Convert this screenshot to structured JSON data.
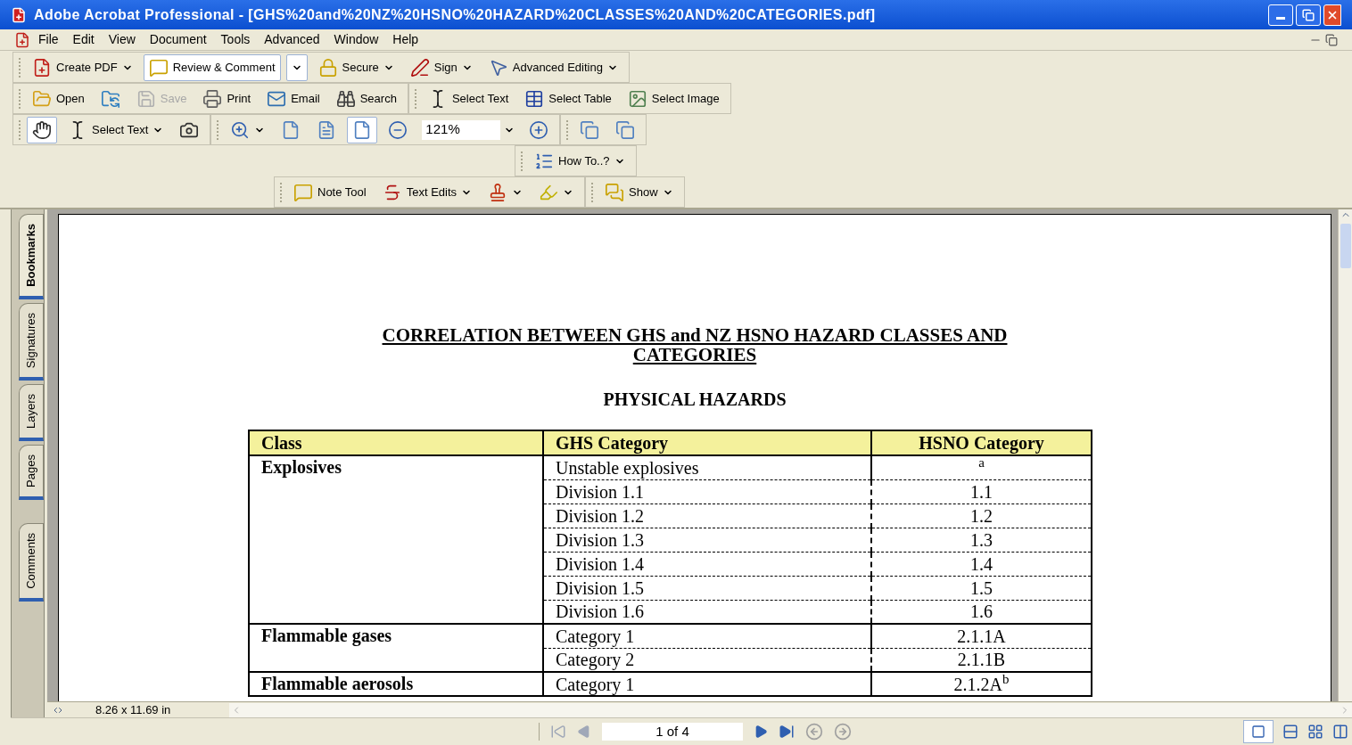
{
  "window": {
    "title": "Adobe Acrobat Professional - [GHS%20and%20NZ%20HSNO%20HAZARD%20CLASSES%20AND%20CATEGORIES.pdf]"
  },
  "menu": [
    "File",
    "Edit",
    "View",
    "Document",
    "Tools",
    "Advanced",
    "Window",
    "Help"
  ],
  "toolbars": [
    {
      "groups": [
        [
          {
            "label": "Create PDF",
            "menu": true,
            "pressed": false,
            "disabled": false
          },
          {
            "label": "Review & Comment",
            "menu": false,
            "pressed": true,
            "disabled": false
          },
          {
            "menu": true,
            "pressed": true,
            "disabled": false
          },
          {
            "label": "Secure",
            "menu": true,
            "pressed": false,
            "disabled": false
          },
          {
            "label": "Sign",
            "menu": true,
            "pressed": false,
            "disabled": false
          },
          {
            "label": "Advanced Editing",
            "menu": true,
            "pressed": false,
            "disabled": false
          }
        ]
      ]
    },
    {
      "groups": [
        [
          {
            "label": "Open",
            "menu": false,
            "pressed": false,
            "disabled": false
          },
          {
            "menu": false,
            "pressed": false,
            "disabled": false
          },
          {
            "label": "Save",
            "menu": false,
            "pressed": false,
            "disabled": true
          },
          {
            "label": "Print",
            "menu": false,
            "pressed": false,
            "disabled": false
          },
          {
            "label": "Email",
            "menu": false,
            "pressed": false,
            "disabled": false
          },
          {
            "label": "Search",
            "menu": false,
            "pressed": false,
            "disabled": false
          }
        ],
        [
          {
            "label": "Select Text",
            "menu": false,
            "pressed": false,
            "disabled": false
          },
          {
            "label": "Select Table",
            "menu": false,
            "pressed": false,
            "disabled": false
          },
          {
            "label": "Select Image",
            "menu": false,
            "pressed": false,
            "disabled": false
          }
        ]
      ]
    },
    {
      "groups": [
        [
          {
            "menu": false,
            "pressed": true,
            "disabled": false
          },
          {
            "label": "Select Text",
            "menu": true,
            "pressed": false,
            "disabled": false
          },
          {
            "menu": false,
            "pressed": false,
            "disabled": false
          }
        ],
        [
          {
            "menu": true,
            "pressed": false,
            "disabled": false
          },
          {
            "menu": false,
            "pressed": false,
            "disabled": false
          },
          {
            "menu": false,
            "pressed": false,
            "disabled": false
          },
          {
            "menu": false,
            "pressed": true,
            "disabled": false
          },
          {
            "menu": false,
            "pressed": false,
            "disabled": false
          },
          {
            "value": "121%",
            "menu": true,
            "pressed": false,
            "disabled": false
          },
          {
            "menu": false,
            "pressed": false,
            "disabled": false
          }
        ],
        [
          {
            "menu": false,
            "pressed": false,
            "disabled": false
          },
          {
            "menu": false,
            "pressed": false,
            "disabled": false
          }
        ]
      ]
    },
    {
      "groups": [
        [
          {
            "label": "How To..?",
            "menu": true,
            "pressed": false,
            "disabled": false
          }
        ]
      ]
    },
    {
      "groups": [
        [
          {
            "label": "Note Tool",
            "menu": false,
            "pressed": false,
            "disabled": false
          },
          {
            "label": "Text Edits",
            "menu": true,
            "pressed": false,
            "disabled": false
          },
          {
            "menu": true,
            "pressed": false,
            "disabled": false
          },
          {
            "menu": true,
            "pressed": false,
            "disabled": false
          }
        ],
        [
          {
            "label": "Show",
            "menu": true,
            "pressed": false,
            "disabled": false
          }
        ]
      ]
    }
  ],
  "side_tabs": [
    {
      "label": "Bookmarks",
      "selected": true
    },
    {
      "label": "Signatures",
      "selected": false
    },
    {
      "label": "Layers",
      "selected": false
    },
    {
      "label": "Pages",
      "selected": false
    },
    {
      "label": "Comments",
      "selected": false
    }
  ],
  "document": {
    "title": "CORRELATION BETWEEN GHS and NZ HSNO HAZARD CLASSES AND CATEGORIES",
    "heading": "PHYSICAL HAZARDS",
    "table": {
      "columns": [
        "Class",
        "GHS Category",
        "HSNO Category"
      ],
      "groups": [
        {
          "class": "Explosives",
          "rows": [
            {
              "ghs": "Unstable explosives",
              "hsno": "$^{a}$"
            },
            {
              "ghs": "Division 1.1",
              "hsno": "1.1"
            },
            {
              "ghs": "Division 1.2",
              "hsno": "1.2"
            },
            {
              "ghs": "Division 1.3",
              "hsno": "1.3"
            },
            {
              "ghs": "Division 1.4",
              "hsno": "1.4"
            },
            {
              "ghs": "Division 1.5",
              "hsno": "1.5"
            },
            {
              "ghs": "Division 1.6",
              "hsno": "1.6"
            }
          ]
        },
        {
          "class": "Flammable gases",
          "rows": [
            {
              "ghs": "Category 1",
              "hsno": "2.1.1A"
            },
            {
              "ghs": "Category 2",
              "hsno": "2.1.1B"
            }
          ]
        },
        {
          "class": "Flammable aerosols",
          "rows": [
            {
              "ghs": "Category 1",
              "hsno": "2.1.2A$^{b}$"
            }
          ]
        }
      ]
    }
  },
  "page_size": "8.26 x 11.69 in",
  "status_bar": {
    "page": "1 of 4"
  }
}
